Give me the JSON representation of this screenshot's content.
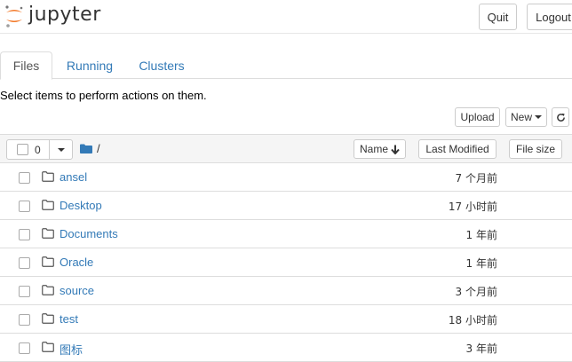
{
  "app": {
    "logo_text": "jupyter",
    "quit_label": "Quit",
    "logout_label": "Logout"
  },
  "tabs": [
    {
      "label": "Files"
    },
    {
      "label": "Running"
    },
    {
      "label": "Clusters"
    }
  ],
  "toolbar": {
    "instructions": "Select items to perform actions on them.",
    "upload_label": "Upload",
    "new_label": "New"
  },
  "list_header": {
    "selected_count": "0",
    "path": "/",
    "sort_name": "Name",
    "sort_last_modified": "Last Modified",
    "sort_file_size": "File size"
  },
  "rows": [
    {
      "name": "ansel",
      "modified": "7 个月前"
    },
    {
      "name": "Desktop",
      "modified": "17 小时前"
    },
    {
      "name": "Documents",
      "modified": "1 年前"
    },
    {
      "name": "Oracle",
      "modified": "1 年前"
    },
    {
      "name": "source",
      "modified": "3 个月前"
    },
    {
      "name": "test",
      "modified": "18 小时前"
    },
    {
      "name": "图标",
      "modified": "3 年前"
    }
  ],
  "colors": {
    "link": "#337ab7",
    "logo_orange": "#f37726",
    "folder_blue": "#337ab7"
  }
}
